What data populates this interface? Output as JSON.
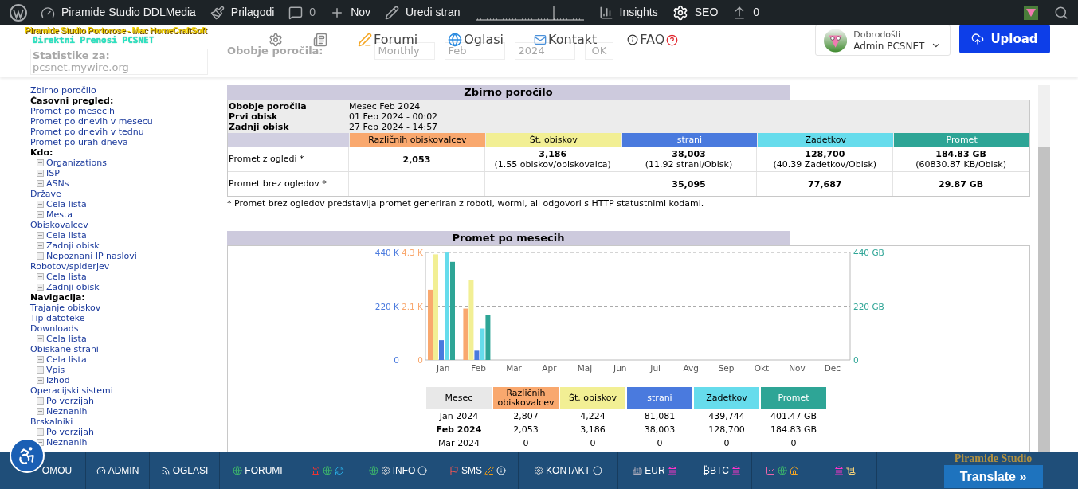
{
  "admin_bar": {
    "items": [
      {
        "kind": "wp"
      },
      {
        "kind": "site",
        "label": "Piramide Studio DDLMedia"
      },
      {
        "kind": "customize",
        "label": "Prilagodi"
      },
      {
        "kind": "comments",
        "label": "0"
      },
      {
        "kind": "new",
        "label": "Nov"
      },
      {
        "kind": "edit",
        "label": "Uredi stran"
      },
      {
        "kind": "sparkline"
      },
      {
        "kind": "insights",
        "label": "Insights"
      },
      {
        "kind": "seo",
        "label": "SEO"
      },
      {
        "kind": "updates",
        "label": "0"
      }
    ]
  },
  "header": {
    "logo_title": "Piramide Studio Portorose - Mac HomeCraftSoft",
    "logo_subtitle": "Direktni Prenosi PCSNET",
    "nav": [
      {
        "kind": "gear"
      },
      {
        "kind": "news"
      },
      {
        "kind": "forum",
        "label": "Forumi"
      },
      {
        "kind": "globe",
        "label": "Oglasi"
      },
      {
        "kind": "mail",
        "label": "Kontakt"
      },
      {
        "kind": "faq",
        "label": "FAQ"
      }
    ],
    "behind": {
      "stats_label": "Statistike za:",
      "stats_value": "pcsnet.mywire.org",
      "report_label": "Obobje poročila:",
      "selects": [
        "Monthly",
        "Feb",
        "2024"
      ],
      "ok": "OK"
    },
    "user": {
      "greeting": "Dobrodošli",
      "name": "Admin PCSNET"
    },
    "upload": "Upload"
  },
  "sidebar": {
    "items": [
      {
        "kind": "link",
        "label": "Zbirno poročilo"
      },
      {
        "kind": "heading",
        "label": "Časovni pregled:"
      },
      {
        "kind": "link",
        "label": "Promet po mesecih"
      },
      {
        "kind": "link",
        "label": "Promet po dnevih v mesecu"
      },
      {
        "kind": "link",
        "label": "Promet po dnevih v tednu"
      },
      {
        "kind": "link",
        "label": "Promet po urah dneva"
      },
      {
        "kind": "heading",
        "label": "Kdo:",
        "children": [
          {
            "label": "Organizations"
          },
          {
            "label": "ISP"
          },
          {
            "label": "ASNs"
          }
        ]
      },
      {
        "kind": "link",
        "label": "Države",
        "children": [
          {
            "label": "Cela lista"
          },
          {
            "label": "Mesta"
          }
        ]
      },
      {
        "kind": "link",
        "label": "Obiskovalcev",
        "children": [
          {
            "label": "Cela lista"
          },
          {
            "label": "Zadnji obisk"
          },
          {
            "label": "Nepoznani IP naslovi"
          }
        ]
      },
      {
        "kind": "link",
        "label": "Robotov/spiderjev",
        "children": [
          {
            "label": "Cela lista"
          },
          {
            "label": "Zadnji obisk"
          }
        ]
      },
      {
        "kind": "heading",
        "label": "Navigacija:"
      },
      {
        "kind": "link",
        "label": "Trajanje obiskov"
      },
      {
        "kind": "link",
        "label": "Tip datoteke"
      },
      {
        "kind": "link",
        "label": "Downloads",
        "children": [
          {
            "label": "Cela lista"
          }
        ]
      },
      {
        "kind": "link",
        "label": "Obiskane strani",
        "children": [
          {
            "label": "Cela lista"
          },
          {
            "label": "Vpis"
          },
          {
            "label": "Izhod"
          }
        ]
      },
      {
        "kind": "link",
        "label": "Operacijski sistemi",
        "children": [
          {
            "label": "Po verzijah"
          },
          {
            "label": "Neznanih"
          }
        ]
      },
      {
        "kind": "link",
        "label": "Brskalniki",
        "children": [
          {
            "label": "Po verzijah"
          },
          {
            "label": "Neznanih"
          }
        ]
      }
    ]
  },
  "summary": {
    "title": "Zbirno poročilo",
    "info": [
      {
        "label": "Obobje poročila",
        "value": "Mesec Feb 2024"
      },
      {
        "label": "Prvi obisk",
        "value": "01 Feb 2024 - 00:02"
      },
      {
        "label": "Zadnji obisk",
        "value": "27 Feb 2024 - 14:57"
      }
    ],
    "columns": [
      {
        "label": "Različnih obiskovalcev",
        "color": "#f9a86e"
      },
      {
        "label": "Št. obiskov",
        "color": "#f2ef94"
      },
      {
        "label": "strani",
        "color": "#4a7ade"
      },
      {
        "label": "Zadetkov",
        "color": "#66dcec"
      },
      {
        "label": "Promet",
        "color": "#2ea596"
      }
    ],
    "rows": [
      {
        "label": "Promet z ogledi *",
        "cells": [
          {
            "value": "2,053"
          },
          {
            "value": "3,186",
            "note": "(1.55 obiskov/obiskovalca)"
          },
          {
            "value": "38,003",
            "note": "(11.92 strani/Obisk)"
          },
          {
            "value": "128,700",
            "note": "(40.39 Zadetkov/Obisk)"
          },
          {
            "value": "184.83 GB",
            "note": "(60830.87 KB/Obisk)"
          }
        ]
      },
      {
        "label": "Promet brez ogledov *",
        "cells": [
          null,
          null,
          {
            "value": "35,095"
          },
          {
            "value": "77,687"
          },
          {
            "value": "29.87 GB"
          }
        ]
      }
    ],
    "footnote": "* Promet brez ogledov predstavlja promet generiran z roboti, wormi, ali odgovori s HTTP statustnimi kodami."
  },
  "monthly": {
    "title": "Promet po mesecih",
    "axes": [
      {
        "kind": "pages",
        "color": "#4a7ade",
        "ticks": [
          "440 K",
          "220 K",
          "0"
        ]
      },
      {
        "kind": "visits",
        "color": "#f9a86e",
        "ticks": [
          "4.3 K",
          "2.1 K",
          "0"
        ]
      },
      {
        "kind": "bandwidth",
        "color": "#2ea596",
        "ticks": [
          "440 GB",
          "220 GB",
          "0"
        ]
      }
    ],
    "months": [
      "Jan",
      "Feb",
      "Mar",
      "Apr",
      "Maj",
      "Jun",
      "Jul",
      "Avg",
      "Sep",
      "Okt",
      "Nov",
      "Dec"
    ],
    "table": {
      "columns": [
        {
          "kind": "month",
          "label": "Mesec",
          "color": "#e8e8e8"
        },
        {
          "kind": "visits",
          "label": "Različnih obiskovalcev",
          "color": "#f9a86e"
        },
        {
          "kind": "visits",
          "label": "Št. obiskov",
          "color": "#f2ef94"
        },
        {
          "kind": "pages",
          "label": "strani",
          "color": "#4a7ade"
        },
        {
          "kind": "pages",
          "label": "Zadetkov",
          "color": "#66dcec"
        },
        {
          "kind": "bandwidth",
          "label": "Promet",
          "color": "#2ea596"
        }
      ],
      "rows": [
        {
          "current": false,
          "cells": [
            "Jan 2024",
            "2,807",
            "4,224",
            "81,081",
            "439,744",
            "401.47 GB"
          ]
        },
        {
          "current": true,
          "cells": [
            "Feb 2024",
            "2,053",
            "3,186",
            "38,003",
            "128,700",
            "184.83 GB"
          ]
        },
        {
          "current": false,
          "cells": [
            "Mar 2024",
            "0",
            "0",
            "0",
            "0",
            "0"
          ]
        }
      ]
    }
  },
  "bottom_bar": {
    "items": [
      {
        "label": "OMOU"
      },
      {
        "label": "ADMIN",
        "before": [
          {
            "kind": "gauge"
          }
        ]
      },
      {
        "label": "OGLASI",
        "before": [
          {
            "kind": "rss"
          }
        ]
      },
      {
        "label": "FORUMI",
        "before": [
          {
            "kind": "globe"
          }
        ]
      },
      {
        "before": [
          {
            "kind": "disk"
          },
          {
            "kind": "globe"
          },
          {
            "kind": "refresh"
          }
        ]
      },
      {
        "label": "INFO",
        "before": [
          {
            "kind": "globe"
          },
          {
            "kind": "gear"
          }
        ],
        "after": [
          {
            "kind": "record"
          }
        ]
      },
      {
        "label": "SMS",
        "before": [
          {
            "kind": "flag"
          }
        ],
        "after": [
          {
            "kind": "pencil"
          },
          {
            "kind": "info"
          }
        ]
      },
      {
        "label": "KONTAKT",
        "before": [
          {
            "kind": "gear"
          }
        ],
        "after": [
          {
            "kind": "record"
          }
        ]
      },
      {
        "label": "EUR",
        "before": [
          {
            "kind": "building"
          }
        ],
        "after": [
          {
            "kind": "bank"
          }
        ]
      },
      {
        "label": "₿BTC",
        "after": [
          {
            "kind": "bank"
          }
        ]
      },
      {
        "before": [
          {
            "kind": "chart"
          },
          {
            "kind": "globe"
          },
          {
            "kind": "house"
          }
        ]
      },
      {
        "before": [
          {
            "kind": "bank"
          },
          {
            "kind": "scroll"
          }
        ]
      }
    ],
    "banner": "Piramide Studio",
    "translate": "Translate »"
  }
}
